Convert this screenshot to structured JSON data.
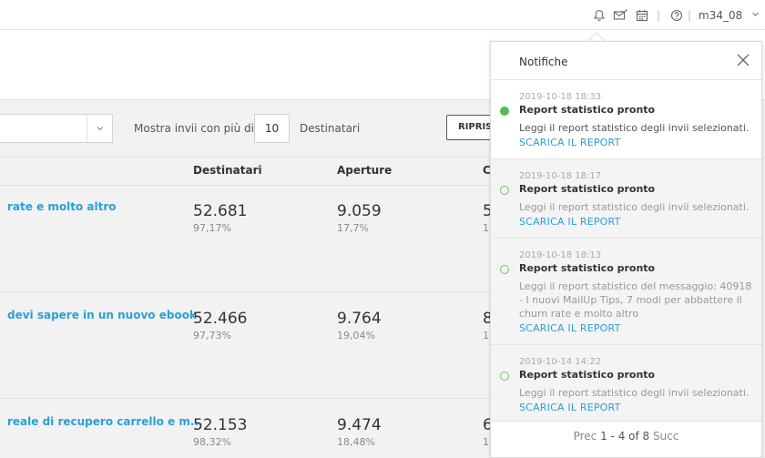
{
  "topbar": {
    "icons": [
      "bell-icon",
      "mail-check-icon",
      "calendar-icon",
      "help-icon",
      "chevron-down-icon"
    ],
    "separator": "|",
    "username": "m34_08"
  },
  "filter": {
    "show_label": "Mostra invii con più di",
    "min_value": "10",
    "suffix": "Destinatari",
    "reset_label": "RIPRISTINA"
  },
  "table": {
    "columns": [
      "Destinatari",
      "Aperture",
      "C"
    ],
    "rows": [
      {
        "title": "rate e molto altro",
        "recipients": "52.681",
        "recipients_pct": "97,17%",
        "opens": "9.059",
        "opens_pct": "17,7%",
        "c_big": "5",
        "c_small": "1"
      },
      {
        "title": "devi sapere in un nuovo ebook",
        "recipients": "52.466",
        "recipients_pct": "97,73%",
        "opens": "9.764",
        "opens_pct": "19,04%",
        "c_big": "8",
        "c_small": "1"
      },
      {
        "title": "reale di recupero carrello e m...",
        "recipients": "52.153",
        "recipients_pct": "98,32%",
        "opens": "9.474",
        "opens_pct": "18,48%",
        "c_big": "6",
        "c_small": "1"
      }
    ]
  },
  "notifications": {
    "title": "Notifiche",
    "items": [
      {
        "timestamp": "2019-10-18 18:33",
        "title": "Report statistico pronto",
        "body": "Leggi il report statistico degli invii selezionati.",
        "link": "SCARICA IL REPORT",
        "unread": true
      },
      {
        "timestamp": "2019-10-18 18:17",
        "title": "Report statistico pronto",
        "body": "Leggi il report statistico degli invii selezionati.",
        "link": "SCARICA IL REPORT",
        "unread": false
      },
      {
        "timestamp": "2019-10-18 18:13",
        "title": "Report statistico pronto",
        "body": "Leggi il report statistico del messaggio: 40918 - I nuovi MailUp Tips, 7 modi per abbattere il churn rate e molto altro",
        "link": "SCARICA IL REPORT",
        "unread": false
      },
      {
        "timestamp": "2019-10-14 14:22",
        "title": "Report statistico pronto",
        "body": "Leggi il report statistico degli invii selezionati.",
        "link": "SCARICA IL REPORT",
        "unread": false
      }
    ],
    "pager": {
      "prev": "Prec",
      "count": "1 - 4 of 8",
      "next": "Succ"
    }
  },
  "colors": {
    "accent": "#2a9fd8",
    "dot": "#4fbf4f"
  }
}
